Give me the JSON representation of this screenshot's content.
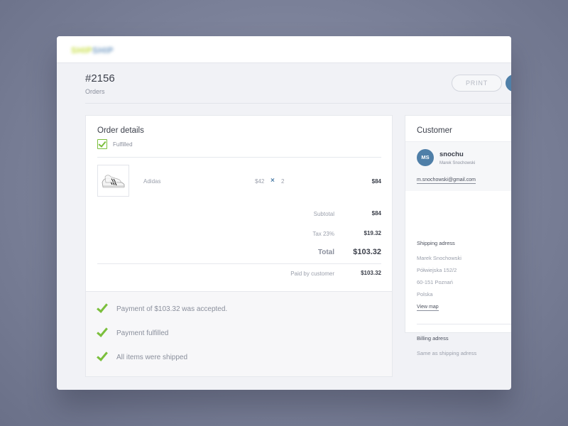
{
  "app": {
    "logo_part1": "SHIP",
    "logo_part2": "SHIP"
  },
  "header": {
    "order_number": "#2156",
    "breadcrumb": "Orders",
    "print_label": "PRINT"
  },
  "order_details": {
    "title": "Order details",
    "status_label": "Fulfilled",
    "item": {
      "name": "Adidas",
      "unit_price": "$42",
      "qty_symbol": "×",
      "quantity": "2",
      "line_total": "$84"
    },
    "summary": {
      "subtotal_label": "Subtotal",
      "subtotal_value": "$84",
      "tax_label": "Tax 23%",
      "tax_value": "$19.32",
      "total_label": "Total",
      "total_value": "$103.32",
      "paid_label": "Paid by customer",
      "paid_value": "$103.32"
    },
    "events": [
      "Payment of $103.32 was accepted.",
      "Payment fulfilled",
      "All items were shipped"
    ]
  },
  "customer": {
    "title": "Customer",
    "initials": "MS",
    "username": "snochu",
    "full_name": "Marek Snochowski",
    "email": "m.snochowski@gmail.com",
    "shipping": {
      "heading": "Shipping adress",
      "lines": [
        "Marek Snochowski",
        "Półwiejska 152/2",
        "60-151 Poznań",
        "Polska"
      ],
      "map_link": "View map"
    },
    "billing": {
      "heading": "Billing adress",
      "text": "Same as shipping adress"
    }
  },
  "colors": {
    "accent": "#4f7fa8",
    "success": "#7bbf3c",
    "background": "#7b8199"
  }
}
